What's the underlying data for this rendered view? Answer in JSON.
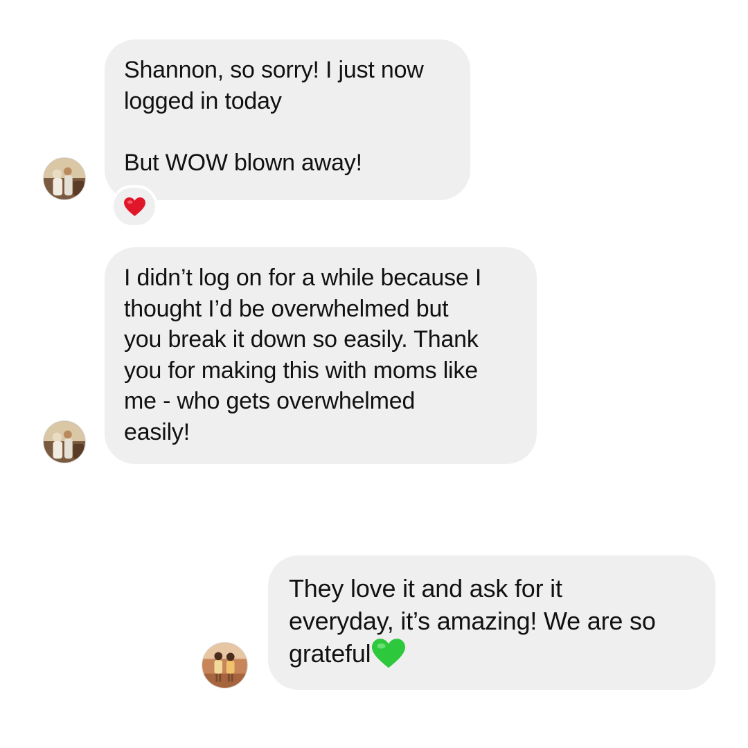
{
  "messages": [
    {
      "sender": "incoming",
      "text": "Shannon, so sorry! I just now\nlogged in today\n\nBut WOW blown away!",
      "reaction_icon": "red-heart-icon",
      "reaction_color": "#e0162b"
    },
    {
      "sender": "incoming",
      "text": "I didn’t log on for a while because I\nthought I’d be overwhelmed but\nyou break it down so easily. Thank\nyou for making this with moms like\nme - who gets overwhelmed\neasily!"
    },
    {
      "sender": "outgoing",
      "text": "They love it and ask for it\neveryday, it’s amazing! We are so\ngrateful",
      "trailing_icon": "green-heart-icon",
      "trailing_icon_color": "#2dc83c"
    }
  ],
  "colors": {
    "bubble_background": "#efefef",
    "page_background": "#ffffff",
    "text": "#111111"
  }
}
